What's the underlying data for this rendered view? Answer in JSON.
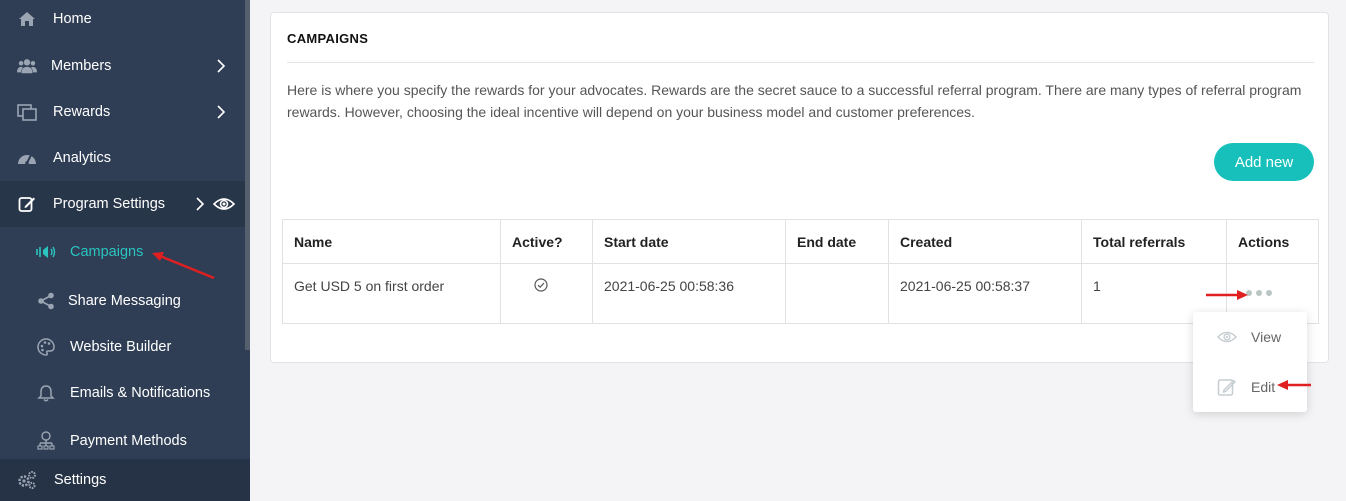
{
  "sidebar": {
    "items": [
      {
        "label": "Home",
        "icon": "home-icon"
      },
      {
        "label": "Members",
        "icon": "members-icon"
      },
      {
        "label": "Rewards",
        "icon": "rewards-icon"
      },
      {
        "label": "Analytics",
        "icon": "analytics-icon"
      },
      {
        "label": "Program Settings",
        "icon": "edit-icon"
      }
    ],
    "subitems": [
      {
        "label": "Campaigns",
        "icon": "campaigns-icon"
      },
      {
        "label": "Share Messaging",
        "icon": "share-icon"
      },
      {
        "label": "Website Builder",
        "icon": "palette-icon"
      },
      {
        "label": "Emails & Notifications",
        "icon": "bell-icon"
      },
      {
        "label": "Payment Methods",
        "icon": "payment-icon"
      }
    ],
    "bottom": {
      "label": "Settings",
      "icon": "gears-icon"
    }
  },
  "card": {
    "title": "CAMPAIGNS",
    "description": "Here is where you specify the rewards for your advocates. Rewards are the secret sauce to a successful referral program. There are many types of referral program rewards. However, choosing the ideal incentive will depend on your business model and customer preferences.",
    "add_button": "Add new"
  },
  "table": {
    "headers": [
      "Name",
      "Active?",
      "Start date",
      "End date",
      "Created",
      "Total referrals",
      "Actions"
    ],
    "rows": [
      {
        "name": "Get USD 5 on first order",
        "active": true,
        "start": "2021-06-25 00:58:36",
        "end": "",
        "created": "2021-06-25 00:58:37",
        "referrals": "1"
      }
    ]
  },
  "actions_menu": {
    "items": [
      {
        "label": "View",
        "icon": "eye-icon"
      },
      {
        "label": "Edit",
        "icon": "edit-icon"
      }
    ]
  },
  "colors": {
    "sidebar": "#2f3e55",
    "accent": "#17c0bb",
    "annotation_arrow": "#e02020"
  }
}
